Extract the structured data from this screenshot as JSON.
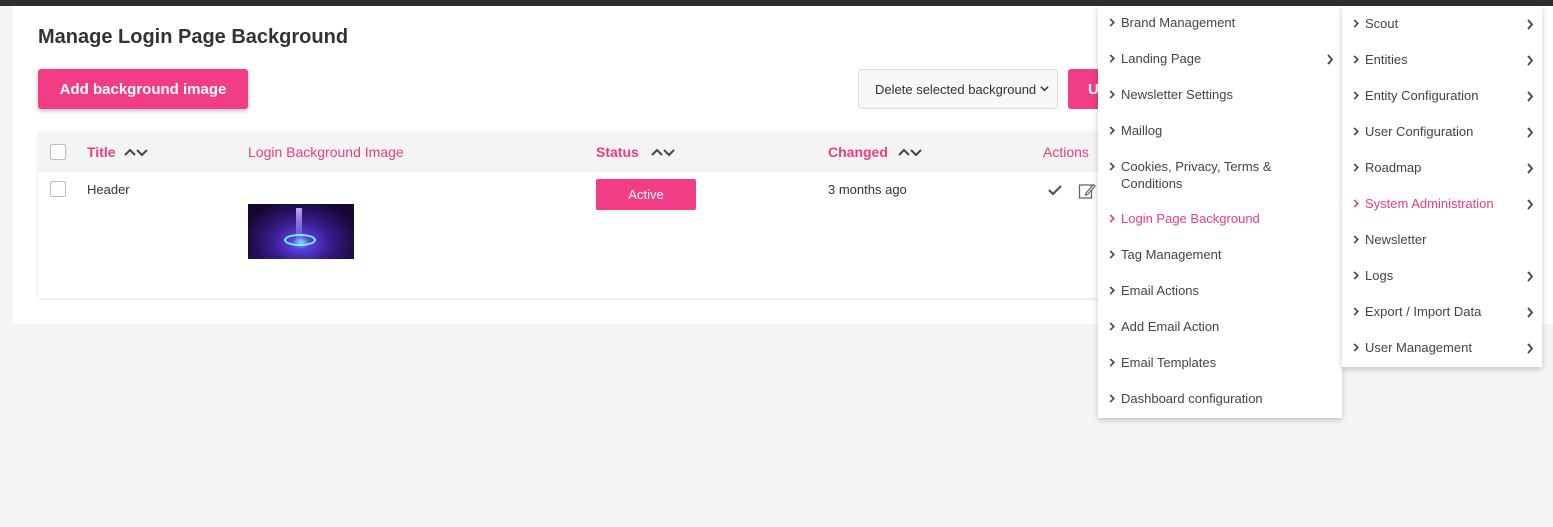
{
  "page": {
    "title": "Manage Login Page Background",
    "add_button": "Add background image",
    "bulk_select_value": "Delete selected background",
    "update_button": "U"
  },
  "table": {
    "headers": {
      "title": "Title",
      "image": "Login Background Image",
      "status": "Status",
      "changed": "Changed",
      "actions": "Actions"
    },
    "rows": [
      {
        "title": "Header",
        "status": "Active",
        "changed": "3 months ago"
      }
    ]
  },
  "menu_left": {
    "items": [
      {
        "label": "Brand Management",
        "has_sub": false
      },
      {
        "label": "Landing Page",
        "has_sub": true
      },
      {
        "label": "Newsletter Settings",
        "has_sub": false
      },
      {
        "label": "Maillog",
        "has_sub": false
      },
      {
        "label": "Cookies, Privacy, Terms &",
        "label2": "Conditions",
        "has_sub": false
      },
      {
        "label": "Login Page Background",
        "has_sub": false,
        "active": true
      },
      {
        "label": "Tag Management",
        "has_sub": false
      },
      {
        "label": "Email Actions",
        "has_sub": false
      },
      {
        "label": "Add Email Action",
        "has_sub": false
      },
      {
        "label": "Email Templates",
        "has_sub": false
      },
      {
        "label": "Dashboard configuration",
        "has_sub": false
      }
    ]
  },
  "menu_right": {
    "items": [
      {
        "label": "Scout",
        "has_sub": true
      },
      {
        "label": "Entities",
        "has_sub": true
      },
      {
        "label": "Entity Configuration",
        "has_sub": true
      },
      {
        "label": "User Configuration",
        "has_sub": true
      },
      {
        "label": "Roadmap",
        "has_sub": true
      },
      {
        "label": "System Administration",
        "has_sub": true,
        "active": true
      },
      {
        "label": "Newsletter",
        "has_sub": false
      },
      {
        "label": "Logs",
        "has_sub": true
      },
      {
        "label": "Export / Import Data",
        "has_sub": true
      },
      {
        "label": "User Management",
        "has_sub": true
      }
    ]
  },
  "colors": {
    "accent": "#f23d86",
    "accent_text": "#e83e7d",
    "topbar": "#2e2e2e"
  }
}
